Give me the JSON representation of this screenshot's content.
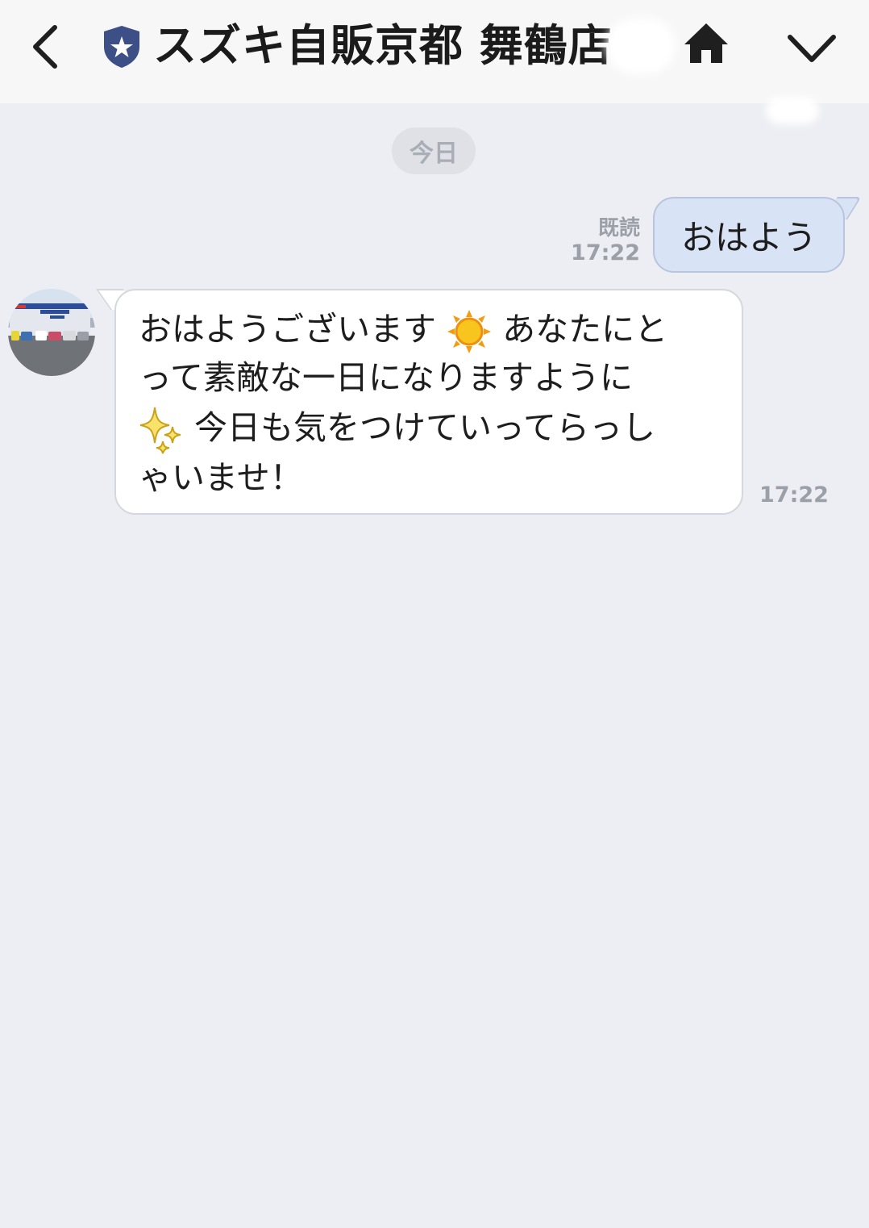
{
  "header": {
    "title": "スズキ自販京都 舞鶴店",
    "back_icon": "chevron-left-icon",
    "badge_icon": "shield-star-icon",
    "home_icon": "home-icon",
    "menu_icon": "chevron-down-icon"
  },
  "date_separator": "今日",
  "messages": [
    {
      "direction": "outgoing",
      "text": "おはよう",
      "read_label": "既読",
      "time": "17:22"
    },
    {
      "direction": "incoming",
      "lines": [
        {
          "pre": "おはようございます",
          "emoji": "sun-emoji",
          "post": "あなたにと"
        },
        {
          "text": "って素敵な一日になりますように"
        },
        {
          "emoji": "sparkles-emoji",
          "post": "今日も気をつけていってらっし"
        },
        {
          "text": "ゃいませ！"
        }
      ],
      "time": "17:22"
    }
  ],
  "colors": {
    "background": "#edeef3",
    "header": "#f7f7f8",
    "outgoing_bubble": "#d9e3f6",
    "incoming_bubble": "#ffffff",
    "shield": "#3c4f86"
  }
}
